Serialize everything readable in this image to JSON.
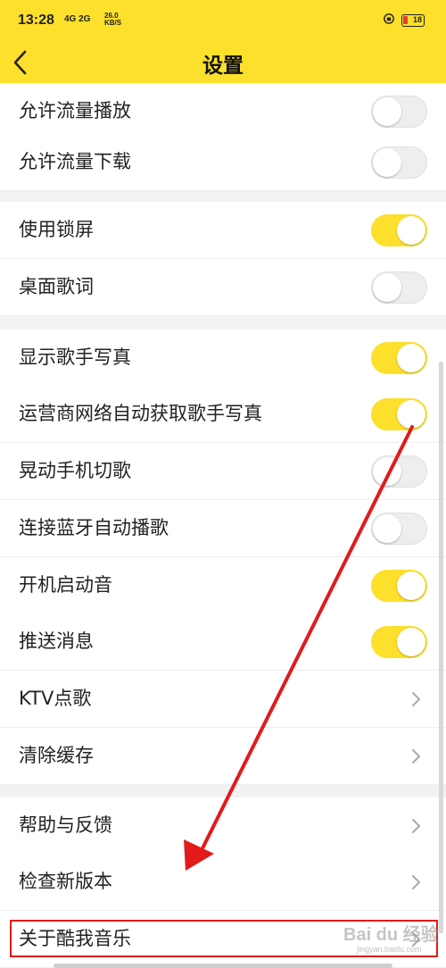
{
  "status_bar": {
    "time": "13:28",
    "network": "4G 2G",
    "speed_value": "26.0",
    "speed_unit": "KB/S",
    "battery": "18"
  },
  "header": {
    "title": "设置",
    "back_icon": "chevron-left-icon",
    "background": "#fde02b"
  },
  "settings": [
    {
      "label": "允许流量播放",
      "control": "toggle",
      "on": false
    },
    {
      "label": "允许流量下载",
      "control": "toggle",
      "on": false
    },
    {
      "label": "使用锁屏",
      "control": "toggle",
      "on": true
    },
    {
      "label": "桌面歌词",
      "control": "toggle",
      "on": false
    },
    {
      "label": "显示歌手写真",
      "control": "toggle",
      "on": true
    },
    {
      "label": "运营商网络自动获取歌手写真",
      "control": "toggle",
      "on": true
    },
    {
      "label": "晃动手机切歌",
      "control": "toggle",
      "on": false
    },
    {
      "label": "连接蓝牙自动播歌",
      "control": "toggle",
      "on": false
    },
    {
      "label": "开机启动音",
      "control": "toggle",
      "on": true
    },
    {
      "label": "推送消息",
      "control": "toggle",
      "on": true
    },
    {
      "label": "KTV点歌",
      "control": "chevron"
    },
    {
      "label": "清除缓存",
      "control": "chevron"
    },
    {
      "label": "帮助与反馈",
      "control": "chevron"
    },
    {
      "label": "检查新版本",
      "control": "chevron"
    },
    {
      "label": "关于酷我音乐",
      "control": "chevron"
    }
  ],
  "annotation": {
    "arrow_color": "#e21a1a",
    "highlight_color": "#e21a1a"
  },
  "watermark": {
    "text": "Bai du 经验",
    "sub": "jingyan.baidu.com"
  }
}
